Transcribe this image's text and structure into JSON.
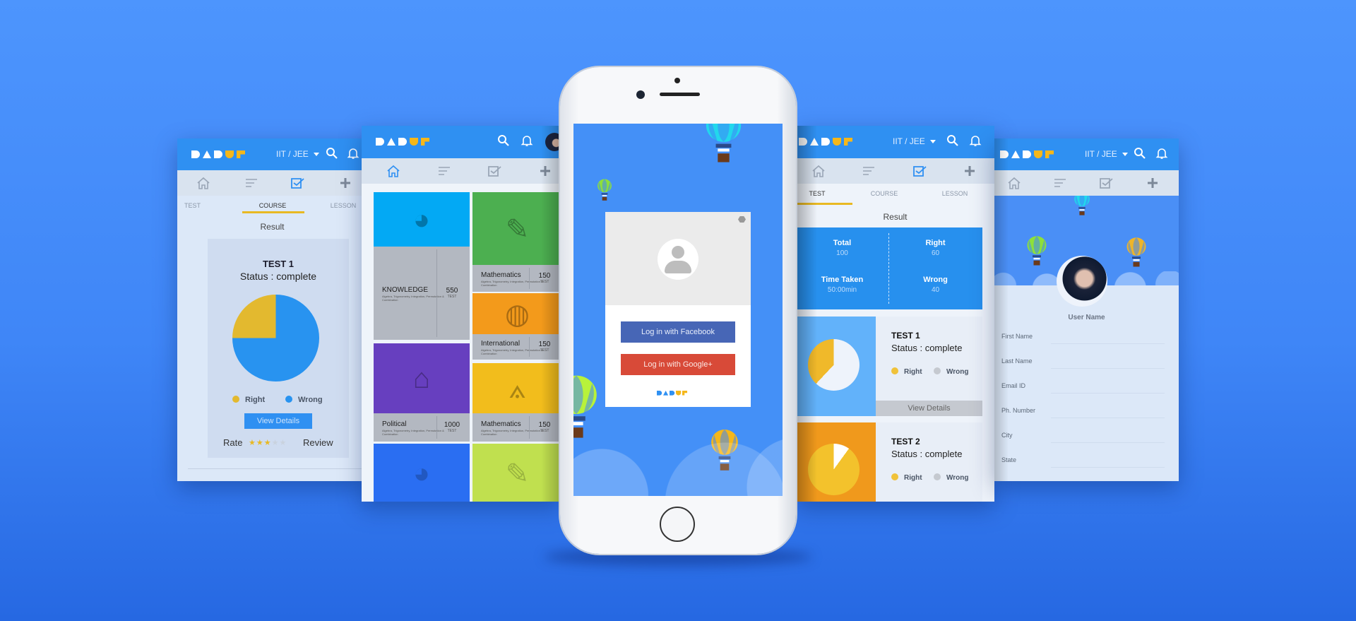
{
  "brand": {
    "logo_text": "DADUF",
    "colors": {
      "header": "#2f90f2",
      "yellow": "#f5b71a",
      "background": "#4d95fd"
    }
  },
  "header": {
    "exam_selector": "IIT / JEE",
    "icons": [
      "search-icon",
      "bell-icon",
      "avatar"
    ]
  },
  "nav_icons": [
    "home-icon",
    "list-icon",
    "checkbox-icon",
    "plus-icon"
  ],
  "tabs": [
    "TEST",
    "COURSE",
    "LESSON"
  ],
  "result_screen": {
    "active_tab": "COURSE",
    "heading": "Result",
    "card": {
      "title": "TEST 1",
      "status": "Status : complete",
      "right_fraction": 0.25,
      "legend": [
        "Right",
        "Wrong"
      ],
      "button": "View Details",
      "rate_label": "Rate",
      "rating": 3,
      "rating_max": 5,
      "review_label": "Review"
    }
  },
  "category_screen": {
    "tiles": [
      {
        "name": "KNOWLEDGE",
        "desc": "Algebra, Trigonometry, Integration, Permutation & Combination",
        "count": "550",
        "unit": "TEST",
        "color": "#03a9f4",
        "icon": "brain-gears-icon"
      },
      {
        "name": "Mathematics",
        "desc": "Algebra, Trigonometry, Integration, Permutation & Combination",
        "count": "150",
        "unit": "TEST",
        "color": "#4caf50",
        "icon": "ruler-pencil-icon"
      },
      {
        "name": "International",
        "desc": "Algebra, Trigonometry, Integration, Permutation & Combination",
        "count": "150",
        "unit": "TEST",
        "color": "#f39a1b",
        "icon": "globe-pin-icon"
      },
      {
        "name": "Political",
        "desc": "Algebra, Trigonometry, Integration, Permutation & Combination",
        "count": "1000",
        "unit": "TEST",
        "color": "#673fbf",
        "icon": "capitol-icon"
      },
      {
        "name": "Mathematics",
        "desc": "Algebra, Trigonometry, Integration, Permutation & Combination",
        "count": "150",
        "unit": "TEST",
        "color": "#f2bd1c",
        "icon": "compass-icon"
      }
    ],
    "more_tiles": [
      {
        "color": "#2a6ef2",
        "icon": "brain-gears-icon"
      },
      {
        "color": "#c0e04f",
        "icon": "ruler-pencil-icon"
      }
    ]
  },
  "login_screen": {
    "facebook_button": "Log in with Facebook",
    "google_button": "Log in with Google+",
    "facebook_color": "#4766b6",
    "google_color": "#d84a38"
  },
  "test_screen": {
    "active_tab": "TEST",
    "heading": "Result",
    "stats": [
      {
        "label": "Total",
        "value": "100"
      },
      {
        "label": "Right",
        "value": "60"
      },
      {
        "label": "Time Taken",
        "value": "50:00min"
      },
      {
        "label": "Wrong",
        "value": "40"
      }
    ],
    "tests": [
      {
        "title": "TEST 1",
        "status": "Status : complete",
        "legend": [
          "Right",
          "Wrong"
        ],
        "right_fraction": 0.38,
        "button": "View Details"
      },
      {
        "title": "TEST 2",
        "status": "Status : complete",
        "legend": [
          "Right",
          "Wrong"
        ],
        "right_fraction": 0.9
      }
    ]
  },
  "profile_screen": {
    "user_name": "User Name",
    "fields": [
      "First Name",
      "Last Name",
      "Email ID",
      "Ph. Number",
      "City",
      "State"
    ]
  }
}
